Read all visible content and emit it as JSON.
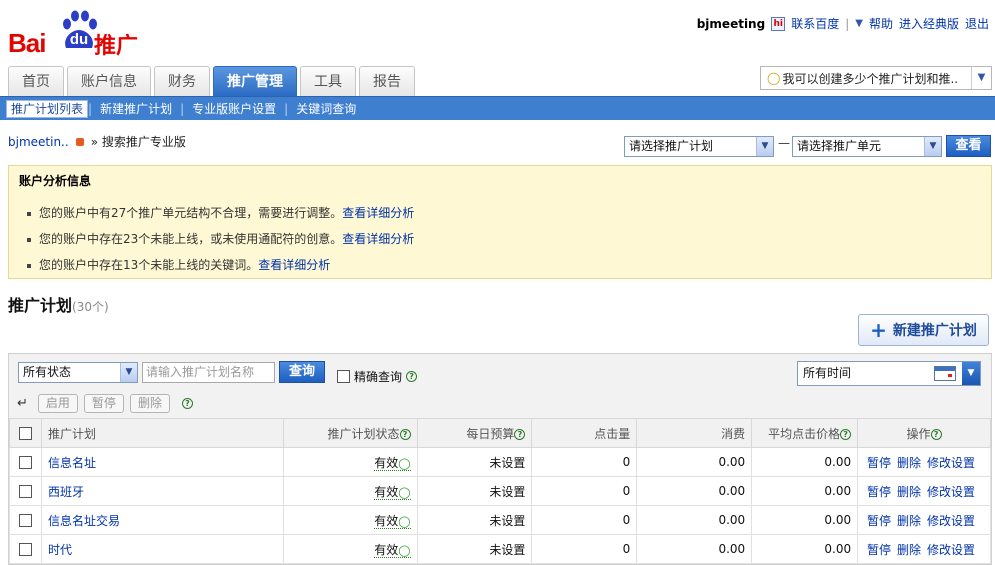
{
  "brand": {
    "logo_bai": "Bai",
    "logo_du": "du",
    "logo_suffix": "推广"
  },
  "toplinks": {
    "user": "bjmeeting",
    "contact": "联系百度",
    "help": "帮助",
    "classic": "进入经典版",
    "logout": "退出"
  },
  "tabs": [
    {
      "label": "首页"
    },
    {
      "label": "账户信息"
    },
    {
      "label": "财务"
    },
    {
      "label": "推广管理",
      "active": true
    },
    {
      "label": "工具"
    },
    {
      "label": "报告"
    }
  ],
  "tip": {
    "text": "我可以创建多少个推广计划和推.."
  },
  "subnav": [
    {
      "label": "推广计划列表",
      "active": true
    },
    {
      "label": "新建推广计划"
    },
    {
      "label": "专业版账户设置"
    },
    {
      "label": "关键词查询"
    }
  ],
  "breadcrumb": {
    "account": "bjmeetin..",
    "current": "» 搜索推广专业版"
  },
  "selectors": {
    "plan": "请选择推广计划",
    "unit": "请选择推广单元",
    "dash": "—",
    "view_button": "查看"
  },
  "analysis": {
    "title": "账户分析信息",
    "items": [
      {
        "text": "您的账户中有27个推广单元结构不合理，需要进行调整。",
        "link": "查看详细分析"
      },
      {
        "text": "您的账户中存在23个未能上线，或未使用通配符的创意。",
        "link": "查看详细分析"
      },
      {
        "text": "您的账户中存在13个未能上线的关键词。",
        "link": "查看详细分析"
      }
    ]
  },
  "plans": {
    "title": "推广计划",
    "count": "(30个)",
    "new_button": "新建推广计划",
    "filter": {
      "status_select": "所有状态",
      "search_placeholder": "请输入推广计划名称",
      "search_button": "查询",
      "exact_label": "精确查询",
      "time_select": "所有时间"
    },
    "actions": {
      "enable": "启用",
      "pause": "暂停",
      "delete": "删除"
    },
    "columns": {
      "name": "推广计划",
      "status": "推广计划状态",
      "budget": "每日预算",
      "clicks": "点击量",
      "cost": "消费",
      "avg_cpc": "平均点击价格",
      "ops": "操作"
    },
    "ops": {
      "pause": "暂停",
      "delete": "删除",
      "edit": "修改设置"
    },
    "rows": [
      {
        "name": "信息名址",
        "status": "有效",
        "budget": "未设置",
        "clicks": "0",
        "cost": "0.00",
        "avg_cpc": "0.00"
      },
      {
        "name": "西班牙",
        "status": "有效",
        "budget": "未设置",
        "clicks": "0",
        "cost": "0.00",
        "avg_cpc": "0.00"
      },
      {
        "name": "信息名址交易",
        "status": "有效",
        "budget": "未设置",
        "clicks": "0",
        "cost": "0.00",
        "avg_cpc": "0.00"
      },
      {
        "name": "时代",
        "status": "有效",
        "budget": "未设置",
        "clicks": "0",
        "cost": "0.00",
        "avg_cpc": "0.00"
      }
    ]
  }
}
